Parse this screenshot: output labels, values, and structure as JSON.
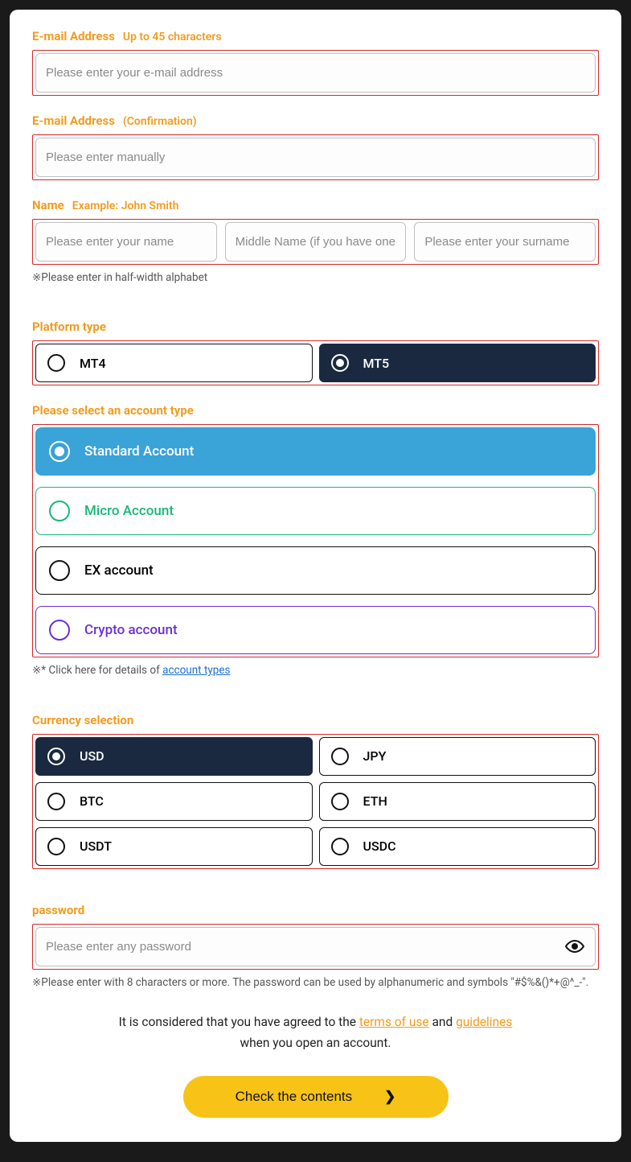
{
  "email": {
    "label": "E-mail Address",
    "sub": "Up to 45 characters",
    "placeholder": "Please enter your e-mail address"
  },
  "email_confirm": {
    "label": "E-mail Address",
    "sub": "(Confirmation)",
    "placeholder": "Please enter manually"
  },
  "name": {
    "label": "Name",
    "sub": "Example: John Smith",
    "first_placeholder": "Please enter your name",
    "middle_placeholder": "Middle Name (if you have one)",
    "last_placeholder": "Please enter your surname",
    "helper": "※Please enter in half-width alphabet"
  },
  "platform": {
    "label": "Platform type",
    "options": [
      "MT4",
      "MT5"
    ],
    "selected": "MT5"
  },
  "account_type": {
    "label": "Please select an account type",
    "options": [
      {
        "label": "Standard Account",
        "style": "sel-blue"
      },
      {
        "label": "Micro Account",
        "style": "outline-teal"
      },
      {
        "label": "EX account",
        "style": ""
      },
      {
        "label": "Crypto account",
        "style": "outline-purple"
      }
    ],
    "helper_prefix": "※* Click here for details of ",
    "helper_link": "account types"
  },
  "currency": {
    "label": "Currency selection",
    "options": [
      "USD",
      "JPY",
      "BTC",
      "ETH",
      "USDT",
      "USDC"
    ],
    "selected": "USD"
  },
  "password": {
    "label": "password",
    "placeholder": "Please enter any password",
    "helper": "※Please enter with 8 characters or more. The password can be used by alphanumeric and symbols \"#$%&()*+@^_-\"."
  },
  "agree": {
    "prefix": "It is considered that you have agreed to the ",
    "link1": "terms of use",
    "mid": " and ",
    "link2": "guidelines",
    "suffix": " when you open an account."
  },
  "submit": {
    "label": "Check the contents"
  }
}
